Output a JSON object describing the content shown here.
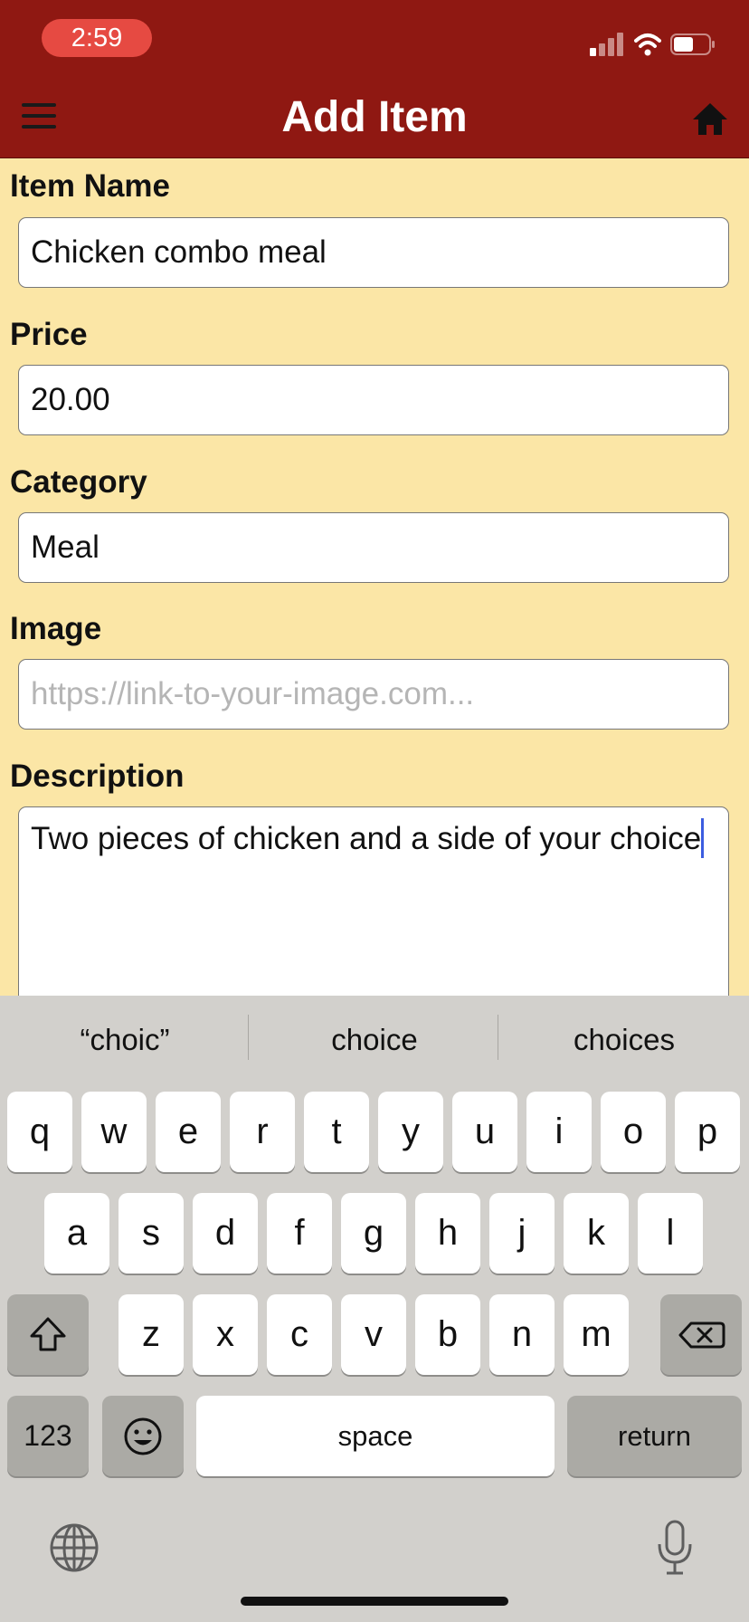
{
  "status_bar": {
    "time": "2:59"
  },
  "header": {
    "title": "Add Item",
    "menu_icon": "hamburger-menu-icon",
    "home_icon": "home-icon",
    "bg_color": "#8f1812"
  },
  "form": {
    "item_name": {
      "label": "Item Name",
      "value": "Chicken combo meal"
    },
    "price": {
      "label": "Price",
      "value": "20.00"
    },
    "category": {
      "label": "Category",
      "value": "Meal"
    },
    "image": {
      "label": "Image",
      "value": "",
      "placeholder": "https://link-to-your-image.com..."
    },
    "description": {
      "label": "Description",
      "value": "Two pieces of chicken and a side of your choice"
    },
    "bg_color": "#fbe6a6"
  },
  "keyboard": {
    "suggestions": [
      "“choic”",
      "choice",
      "choices"
    ],
    "row1": [
      "q",
      "w",
      "e",
      "r",
      "t",
      "y",
      "u",
      "i",
      "o",
      "p"
    ],
    "row2": [
      "a",
      "s",
      "d",
      "f",
      "g",
      "h",
      "j",
      "k",
      "l"
    ],
    "row3": [
      "z",
      "x",
      "c",
      "v",
      "b",
      "n",
      "m"
    ],
    "numbers_label": "123",
    "space_label": "space",
    "return_label": "return"
  }
}
